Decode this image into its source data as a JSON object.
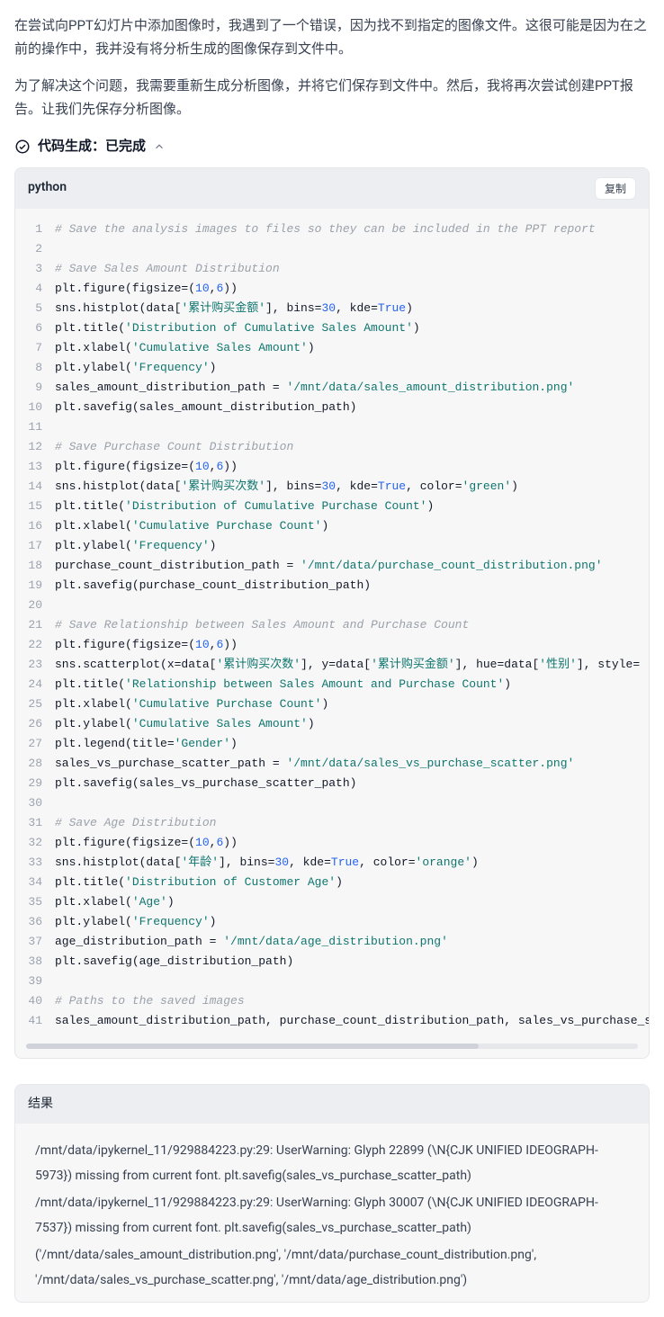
{
  "prose": {
    "p1": "在尝试向PPT幻灯片中添加图像时，我遇到了一个错误，因为找不到指定的图像文件。这很可能是因为在之前的操作中，我并没有将分析生成的图像保存到文件中。",
    "p2": "为了解决这个问题，我需要重新生成分析图像，并将它们保存到文件中。然后，我将再次尝试创建PPT报告。让我们先保存分析图像。"
  },
  "codegen": {
    "label": "代码生成：已完成"
  },
  "code_header": {
    "lang": "python",
    "copy": "复制"
  },
  "code": {
    "lines": [
      {
        "type": "comment",
        "text": "# Save the analysis images to files so they can be included in the PPT report"
      },
      {
        "type": "blank",
        "text": ""
      },
      {
        "type": "comment",
        "text": "# Save Sales Amount Distribution"
      },
      {
        "type": "code",
        "tokens": [
          [
            "id",
            "plt.figure(figsize=("
          ],
          [
            "num",
            "10"
          ],
          [
            "id",
            ","
          ],
          [
            "num",
            "6"
          ],
          [
            "id",
            "))"
          ]
        ]
      },
      {
        "type": "code",
        "tokens": [
          [
            "id",
            "sns.histplot(data["
          ],
          [
            "str",
            "'累计购买金额'"
          ],
          [
            "id",
            "], bins="
          ],
          [
            "num",
            "30"
          ],
          [
            "id",
            ", kde="
          ],
          [
            "kw",
            "True"
          ],
          [
            "id",
            ")"
          ]
        ]
      },
      {
        "type": "code",
        "tokens": [
          [
            "id",
            "plt.title("
          ],
          [
            "str",
            "'Distribution of Cumulative Sales Amount'"
          ],
          [
            "id",
            ")"
          ]
        ]
      },
      {
        "type": "code",
        "tokens": [
          [
            "id",
            "plt.xlabel("
          ],
          [
            "str",
            "'Cumulative Sales Amount'"
          ],
          [
            "id",
            ")"
          ]
        ]
      },
      {
        "type": "code",
        "tokens": [
          [
            "id",
            "plt.ylabel("
          ],
          [
            "str",
            "'Frequency'"
          ],
          [
            "id",
            ")"
          ]
        ]
      },
      {
        "type": "code",
        "tokens": [
          [
            "id",
            "sales_amount_distribution_path = "
          ],
          [
            "str",
            "'/mnt/data/sales_amount_distribution.png'"
          ]
        ]
      },
      {
        "type": "code",
        "tokens": [
          [
            "id",
            "plt.savefig(sales_amount_distribution_path)"
          ]
        ]
      },
      {
        "type": "blank",
        "text": ""
      },
      {
        "type": "comment",
        "text": "# Save Purchase Count Distribution"
      },
      {
        "type": "code",
        "tokens": [
          [
            "id",
            "plt.figure(figsize=("
          ],
          [
            "num",
            "10"
          ],
          [
            "id",
            ","
          ],
          [
            "num",
            "6"
          ],
          [
            "id",
            "))"
          ]
        ]
      },
      {
        "type": "code",
        "tokens": [
          [
            "id",
            "sns.histplot(data["
          ],
          [
            "str",
            "'累计购买次数'"
          ],
          [
            "id",
            "], bins="
          ],
          [
            "num",
            "30"
          ],
          [
            "id",
            ", kde="
          ],
          [
            "kw",
            "True"
          ],
          [
            "id",
            ", color="
          ],
          [
            "str",
            "'green'"
          ],
          [
            "id",
            ")"
          ]
        ]
      },
      {
        "type": "code",
        "tokens": [
          [
            "id",
            "plt.title("
          ],
          [
            "str",
            "'Distribution of Cumulative Purchase Count'"
          ],
          [
            "id",
            ")"
          ]
        ]
      },
      {
        "type": "code",
        "tokens": [
          [
            "id",
            "plt.xlabel("
          ],
          [
            "str",
            "'Cumulative Purchase Count'"
          ],
          [
            "id",
            ")"
          ]
        ]
      },
      {
        "type": "code",
        "tokens": [
          [
            "id",
            "plt.ylabel("
          ],
          [
            "str",
            "'Frequency'"
          ],
          [
            "id",
            ")"
          ]
        ]
      },
      {
        "type": "code",
        "tokens": [
          [
            "id",
            "purchase_count_distribution_path = "
          ],
          [
            "str",
            "'/mnt/data/purchase_count_distribution.png'"
          ]
        ]
      },
      {
        "type": "code",
        "tokens": [
          [
            "id",
            "plt.savefig(purchase_count_distribution_path)"
          ]
        ]
      },
      {
        "type": "blank",
        "text": ""
      },
      {
        "type": "comment",
        "text": "# Save Relationship between Sales Amount and Purchase Count"
      },
      {
        "type": "code",
        "tokens": [
          [
            "id",
            "plt.figure(figsize=("
          ],
          [
            "num",
            "10"
          ],
          [
            "id",
            ","
          ],
          [
            "num",
            "6"
          ],
          [
            "id",
            "))"
          ]
        ]
      },
      {
        "type": "code",
        "tokens": [
          [
            "id",
            "sns.scatterplot(x=data["
          ],
          [
            "str",
            "'累计购买次数'"
          ],
          [
            "id",
            "], y=data["
          ],
          [
            "str",
            "'累计购买金额'"
          ],
          [
            "id",
            "], hue=data["
          ],
          [
            "str",
            "'性别'"
          ],
          [
            "id",
            "], style="
          ]
        ]
      },
      {
        "type": "code",
        "tokens": [
          [
            "id",
            "plt.title("
          ],
          [
            "str",
            "'Relationship between Sales Amount and Purchase Count'"
          ],
          [
            "id",
            ")"
          ]
        ]
      },
      {
        "type": "code",
        "tokens": [
          [
            "id",
            "plt.xlabel("
          ],
          [
            "str",
            "'Cumulative Purchase Count'"
          ],
          [
            "id",
            ")"
          ]
        ]
      },
      {
        "type": "code",
        "tokens": [
          [
            "id",
            "plt.ylabel("
          ],
          [
            "str",
            "'Cumulative Sales Amount'"
          ],
          [
            "id",
            ")"
          ]
        ]
      },
      {
        "type": "code",
        "tokens": [
          [
            "id",
            "plt.legend(title="
          ],
          [
            "str",
            "'Gender'"
          ],
          [
            "id",
            ")"
          ]
        ]
      },
      {
        "type": "code",
        "tokens": [
          [
            "id",
            "sales_vs_purchase_scatter_path = "
          ],
          [
            "str",
            "'/mnt/data/sales_vs_purchase_scatter.png'"
          ]
        ]
      },
      {
        "type": "code",
        "tokens": [
          [
            "id",
            "plt.savefig(sales_vs_purchase_scatter_path)"
          ]
        ]
      },
      {
        "type": "blank",
        "text": ""
      },
      {
        "type": "comment",
        "text": "# Save Age Distribution"
      },
      {
        "type": "code",
        "tokens": [
          [
            "id",
            "plt.figure(figsize=("
          ],
          [
            "num",
            "10"
          ],
          [
            "id",
            ","
          ],
          [
            "num",
            "6"
          ],
          [
            "id",
            "))"
          ]
        ]
      },
      {
        "type": "code",
        "tokens": [
          [
            "id",
            "sns.histplot(data["
          ],
          [
            "str",
            "'年龄'"
          ],
          [
            "id",
            "], bins="
          ],
          [
            "num",
            "30"
          ],
          [
            "id",
            ", kde="
          ],
          [
            "kw",
            "True"
          ],
          [
            "id",
            ", color="
          ],
          [
            "str",
            "'orange'"
          ],
          [
            "id",
            ")"
          ]
        ]
      },
      {
        "type": "code",
        "tokens": [
          [
            "id",
            "plt.title("
          ],
          [
            "str",
            "'Distribution of Customer Age'"
          ],
          [
            "id",
            ")"
          ]
        ]
      },
      {
        "type": "code",
        "tokens": [
          [
            "id",
            "plt.xlabel("
          ],
          [
            "str",
            "'Age'"
          ],
          [
            "id",
            ")"
          ]
        ]
      },
      {
        "type": "code",
        "tokens": [
          [
            "id",
            "plt.ylabel("
          ],
          [
            "str",
            "'Frequency'"
          ],
          [
            "id",
            ")"
          ]
        ]
      },
      {
        "type": "code",
        "tokens": [
          [
            "id",
            "age_distribution_path = "
          ],
          [
            "str",
            "'/mnt/data/age_distribution.png'"
          ]
        ]
      },
      {
        "type": "code",
        "tokens": [
          [
            "id",
            "plt.savefig(age_distribution_path)"
          ]
        ]
      },
      {
        "type": "blank",
        "text": ""
      },
      {
        "type": "comment",
        "text": "# Paths to the saved images"
      },
      {
        "type": "code",
        "tokens": [
          [
            "id",
            "sales_amount_distribution_path, purchase_count_distribution_path, sales_vs_purchase_s"
          ]
        ]
      }
    ]
  },
  "result": {
    "title": "结果",
    "lines": [
      "/mnt/data/ipykernel_11/929884223.py:29: UserWarning: Glyph 22899 (\\N{CJK UNIFIED IDEOGRAPH-5973}) missing from current font. plt.savefig(sales_vs_purchase_scatter_path)",
      "/mnt/data/ipykernel_11/929884223.py:29: UserWarning: Glyph 30007 (\\N{CJK UNIFIED IDEOGRAPH-7537}) missing from current font. plt.savefig(sales_vs_purchase_scatter_path)",
      "('/mnt/data/sales_amount_distribution.png', '/mnt/data/purchase_count_distribution.png', '/mnt/data/sales_vs_purchase_scatter.png', '/mnt/data/age_distribution.png')"
    ]
  }
}
